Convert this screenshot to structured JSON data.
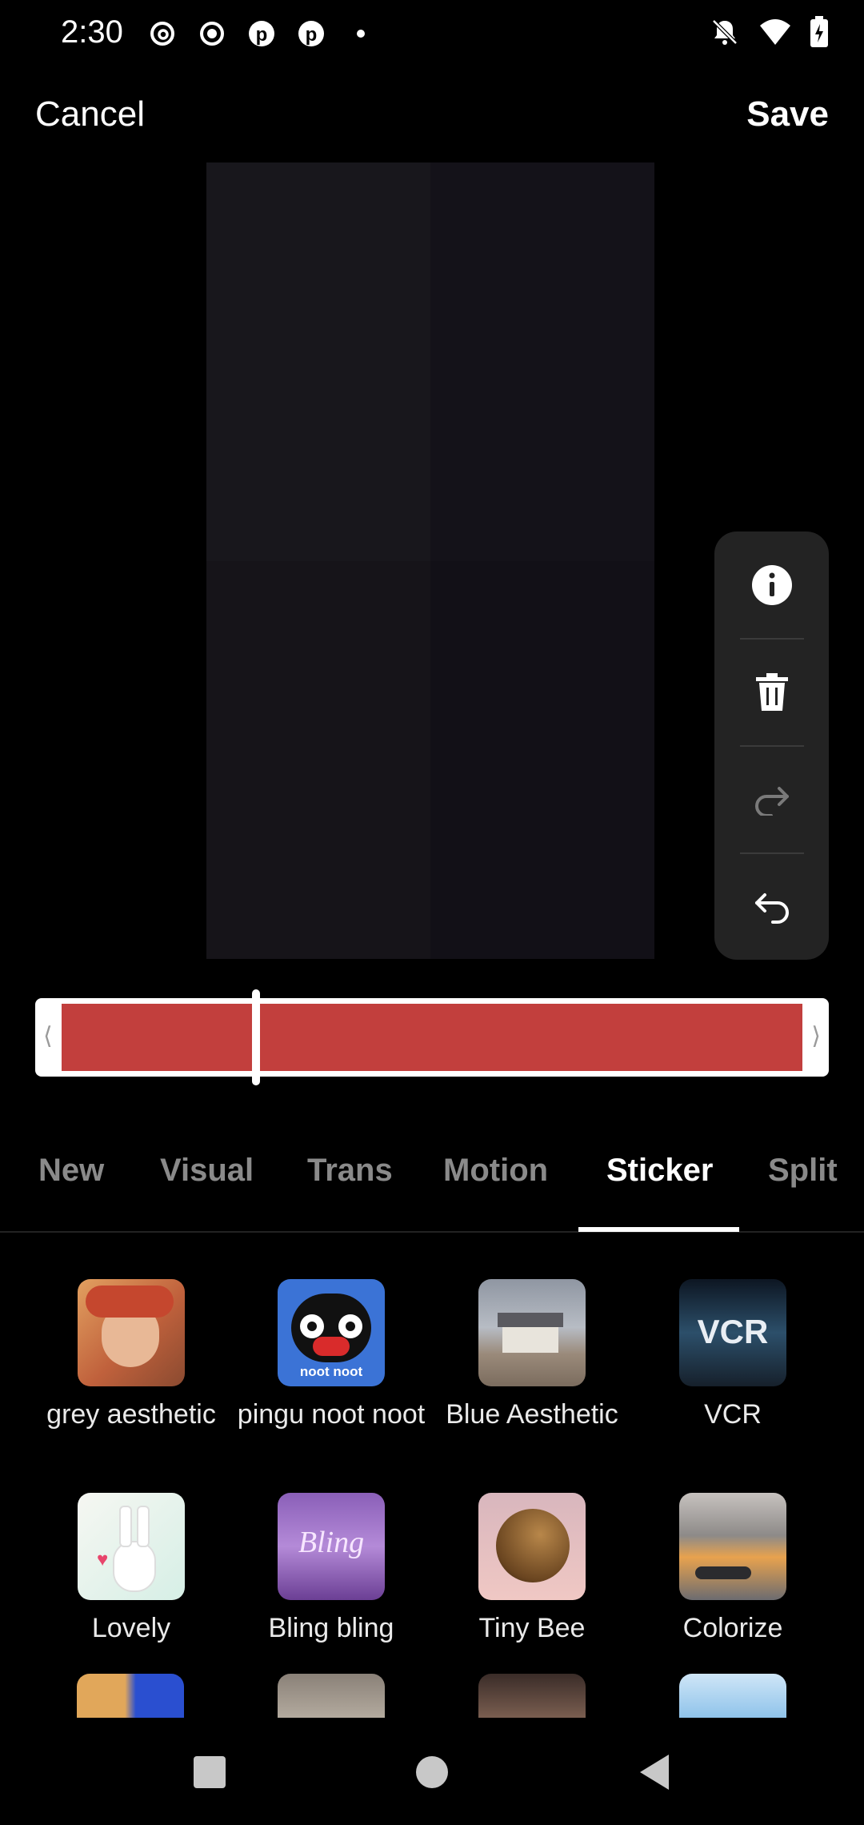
{
  "status_bar": {
    "time": "2:30",
    "left_icons": [
      "threads-icon",
      "record-icon",
      "pinterest-icon",
      "pinterest-icon",
      "dot-icon"
    ],
    "right_icons": [
      "notifications-off-icon",
      "wifi-icon",
      "battery-charging-icon"
    ]
  },
  "header": {
    "cancel_label": "Cancel",
    "save_label": "Save"
  },
  "side_tools": [
    {
      "name": "info-icon"
    },
    {
      "name": "trash-icon"
    },
    {
      "name": "redo-icon"
    },
    {
      "name": "undo-icon"
    }
  ],
  "timeline": {
    "color": "#c23f3d",
    "left_handle": "⟨",
    "right_handle": "⟩"
  },
  "tabs": [
    "New",
    "Visual",
    "Trans",
    "Motion",
    "Sticker",
    "Split"
  ],
  "active_tab": "Sticker",
  "stickers": [
    {
      "label": "grey aesthetic"
    },
    {
      "label": "pingu noot noot",
      "thumb_text": "noot noot"
    },
    {
      "label": "Blue Aesthetic"
    },
    {
      "label": "VCR",
      "thumb_text": "VCR"
    },
    {
      "label": "Lovely"
    },
    {
      "label": "Bling bling",
      "thumb_text": "Bling"
    },
    {
      "label": "Tiny Bee"
    },
    {
      "label": "Colorize"
    }
  ],
  "nav": [
    "recents-square-icon",
    "home-circle-icon",
    "back-triangle-icon"
  ]
}
